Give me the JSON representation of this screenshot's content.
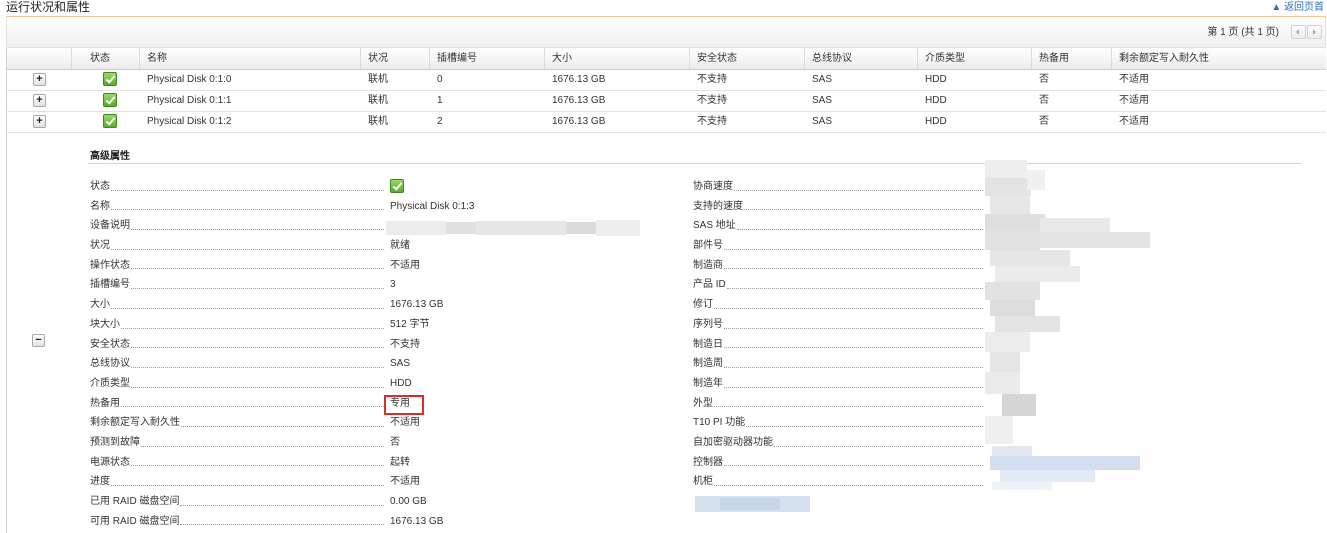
{
  "header": {
    "title": "运行状况和属性",
    "back_to_top": "▲ 返回页首"
  },
  "pagination": {
    "label": "第 1 页 (共 1 页)",
    "prev_icon": "prev-page-icon",
    "next_icon": "next-page-icon"
  },
  "controls": {
    "expand_symbol": "+",
    "collapse_symbol": "−"
  },
  "table": {
    "columns": [
      "状态",
      "名称",
      "状况",
      "插槽编号",
      "大小",
      "安全状态",
      "总线协议",
      "介质类型",
      "热备用",
      "剩余额定写入耐久性"
    ],
    "rows": [
      {
        "status_icon": "check-icon",
        "name": "Physical Disk 0:1:0",
        "condition": "联机",
        "slot": "0",
        "size": "1676.13 GB",
        "security": "不支持",
        "bus": "SAS",
        "media": "HDD",
        "hot_spare": "否",
        "endurance": "不适用"
      },
      {
        "status_icon": "check-icon",
        "name": "Physical Disk 0:1:1",
        "condition": "联机",
        "slot": "1",
        "size": "1676.13 GB",
        "security": "不支持",
        "bus": "SAS",
        "media": "HDD",
        "hot_spare": "否",
        "endurance": "不适用"
      },
      {
        "status_icon": "check-icon",
        "name": "Physical Disk 0:1:2",
        "condition": "联机",
        "slot": "2",
        "size": "1676.13 GB",
        "security": "不支持",
        "bus": "SAS",
        "media": "HDD",
        "hot_spare": "否",
        "endurance": "不适用"
      }
    ]
  },
  "details": {
    "heading": "高级属性",
    "left": [
      {
        "label": "状态",
        "value_icon": "check-icon"
      },
      {
        "label": "名称",
        "value": "Physical Disk 0:1:3"
      },
      {
        "label": "设备说明"
      },
      {
        "label": "状况",
        "value": "就绪"
      },
      {
        "label": "操作状态",
        "value": "不适用"
      },
      {
        "label": "插槽编号",
        "value": "3"
      },
      {
        "label": "大小",
        "value": "1676.13 GB"
      },
      {
        "label": "块大小",
        "value": "512 字节"
      },
      {
        "label": "安全状态",
        "value": "不支持"
      },
      {
        "label": "总线协议",
        "value": "SAS"
      },
      {
        "label": "介质类型",
        "value": "HDD"
      },
      {
        "label": "热备用",
        "value": "专用"
      },
      {
        "label": "剩余额定写入耐久性",
        "value": "不适用"
      },
      {
        "label": "预测到故障",
        "value": "否"
      },
      {
        "label": "电源状态",
        "value": "起转"
      },
      {
        "label": "进度",
        "value": "不适用"
      },
      {
        "label": "已用 RAID 磁盘空间",
        "value": "0.00 GB"
      },
      {
        "label": "可用 RAID 磁盘空间",
        "value": "1676.13 GB"
      }
    ],
    "right": [
      {
        "label": "协商速度"
      },
      {
        "label": "支持的速度"
      },
      {
        "label": "SAS 地址"
      },
      {
        "label": "部件号"
      },
      {
        "label": "制造商"
      },
      {
        "label": "产品 ID"
      },
      {
        "label": "修订"
      },
      {
        "label": "序列号"
      },
      {
        "label": "制造日"
      },
      {
        "label": "制造周"
      },
      {
        "label": "制造年"
      },
      {
        "label": "外型"
      },
      {
        "label": "T10 PI 功能"
      },
      {
        "label": "自加密驱动器功能"
      },
      {
        "label": "控制器"
      },
      {
        "label": "机柜"
      }
    ]
  },
  "colors": {
    "status_ok": "#5aab2c",
    "link": "#2a6ebb",
    "highlight_box": "#e02a2a",
    "pager_top_border": "#f2c48e"
  }
}
